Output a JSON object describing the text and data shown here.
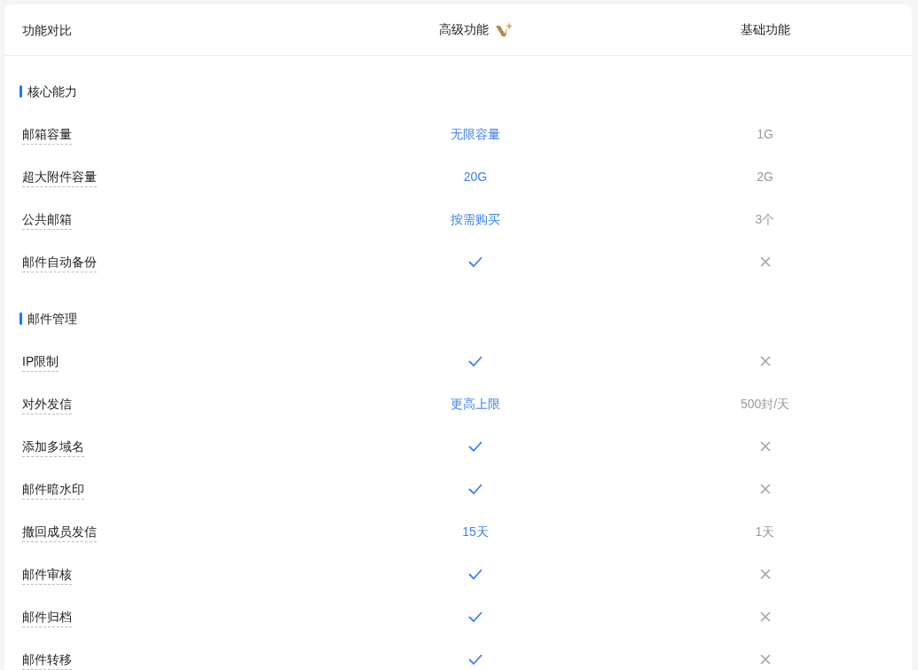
{
  "header": {
    "feature_column": "功能对比",
    "premium_column": "高级功能",
    "basic_column": "基础功能"
  },
  "sections": [
    {
      "title": "核心能力",
      "rows": [
        {
          "feature": "邮箱容量",
          "premium": {
            "kind": "text",
            "text": "无限容量"
          },
          "basic": {
            "kind": "text",
            "text": "1G"
          }
        },
        {
          "feature": "超大附件容量",
          "premium": {
            "kind": "text",
            "text": "20G"
          },
          "basic": {
            "kind": "text",
            "text": "2G"
          }
        },
        {
          "feature": "公共邮箱",
          "premium": {
            "kind": "text",
            "text": "按需购买"
          },
          "basic": {
            "kind": "text",
            "text": "3个"
          }
        },
        {
          "feature": "邮件自动备份",
          "premium": {
            "kind": "check"
          },
          "basic": {
            "kind": "cross"
          }
        }
      ]
    },
    {
      "title": "邮件管理",
      "rows": [
        {
          "feature": "IP限制",
          "premium": {
            "kind": "check"
          },
          "basic": {
            "kind": "cross"
          }
        },
        {
          "feature": "对外发信",
          "premium": {
            "kind": "text",
            "text": "更高上限"
          },
          "basic": {
            "kind": "text",
            "text": "500封/天"
          }
        },
        {
          "feature": "添加多域名",
          "premium": {
            "kind": "check"
          },
          "basic": {
            "kind": "cross"
          }
        },
        {
          "feature": "邮件暗水印",
          "premium": {
            "kind": "check"
          },
          "basic": {
            "kind": "cross"
          }
        },
        {
          "feature": "撤回成员发信",
          "premium": {
            "kind": "text",
            "text": "15天"
          },
          "basic": {
            "kind": "text",
            "text": "1天"
          }
        },
        {
          "feature": "邮件审核",
          "premium": {
            "kind": "check"
          },
          "basic": {
            "kind": "cross"
          }
        },
        {
          "feature": "邮件归档",
          "premium": {
            "kind": "check"
          },
          "basic": {
            "kind": "cross"
          }
        },
        {
          "feature": "邮件转移",
          "premium": {
            "kind": "check"
          },
          "basic": {
            "kind": "cross"
          }
        }
      ]
    }
  ]
}
